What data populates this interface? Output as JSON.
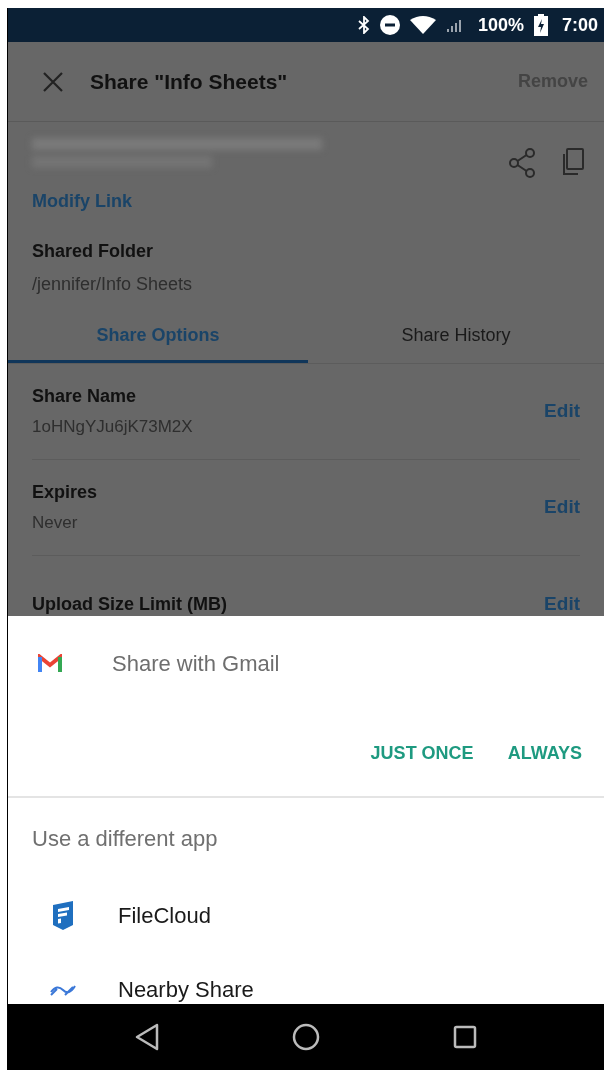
{
  "status_bar": {
    "battery": "100%",
    "time": "7:00"
  },
  "app_bar": {
    "title": "Share \"Info Sheets\"",
    "action": "Remove"
  },
  "link": {
    "modify": "Modify Link"
  },
  "folder": {
    "label": "Shared Folder",
    "path": "/jennifer/Info Sheets"
  },
  "tabs": [
    {
      "label": "Share Options",
      "selected": true
    },
    {
      "label": "Share History",
      "selected": false
    }
  ],
  "options": [
    {
      "label": "Share Name",
      "value": "1oHNgYJu6jK73M2X",
      "action": "Edit"
    },
    {
      "label": "Expires",
      "value": "Never",
      "action": "Edit"
    },
    {
      "label": "Upload Size Limit (MB)",
      "action": "Edit"
    }
  ],
  "sheet": {
    "default_app": "Share with Gmail",
    "buttons": [
      "JUST ONCE",
      "ALWAYS"
    ],
    "other_heading": "Use a different app",
    "apps": [
      {
        "kind": "filecloud",
        "name": "FileCloud"
      },
      {
        "kind": "nearby",
        "name": "Nearby Share"
      }
    ]
  }
}
